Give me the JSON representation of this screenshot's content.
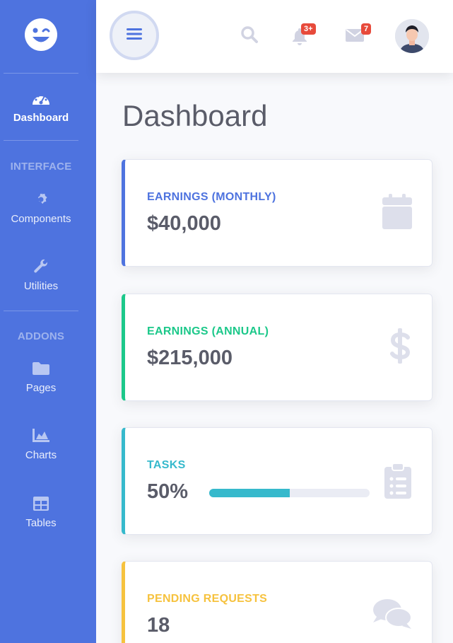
{
  "sidebar": {
    "brand_icon": "laugh-wink-icon",
    "items": [
      {
        "label": "Dashboard",
        "icon": "tachometer-icon",
        "active": true
      },
      {
        "label": "Components",
        "icon": "cog-icon"
      },
      {
        "label": "Utilities",
        "icon": "wrench-icon"
      },
      {
        "label": "Pages",
        "icon": "folder-icon"
      },
      {
        "label": "Charts",
        "icon": "chart-area-icon"
      },
      {
        "label": "Tables",
        "icon": "table-icon"
      }
    ],
    "headings": [
      "INTERFACE",
      "ADDONS"
    ]
  },
  "topbar": {
    "alerts_badge": "3+",
    "messages_badge": "7"
  },
  "page": {
    "title": "Dashboard"
  },
  "cards": [
    {
      "label": "EARNINGS (MONTHLY)",
      "value": "$40,000",
      "color": "#4e73df",
      "icon": "calendar-icon"
    },
    {
      "label": "EARNINGS (ANNUAL)",
      "value": "$215,000",
      "color": "#1cc88a",
      "icon": "dollar-icon"
    },
    {
      "label": "TASKS",
      "value": "50%",
      "color": "#36b9cc",
      "icon": "clipboard-list-icon",
      "progress": 0.5
    },
    {
      "label": "PENDING REQUESTS",
      "value": "18",
      "color": "#f6c23e",
      "icon": "comments-icon"
    }
  ],
  "colors": {
    "sidebar": "#4e73df",
    "primary": "#4e73df",
    "success": "#1cc88a",
    "info": "#36b9cc",
    "warning": "#f6c23e",
    "danger": "#e74a3b"
  }
}
